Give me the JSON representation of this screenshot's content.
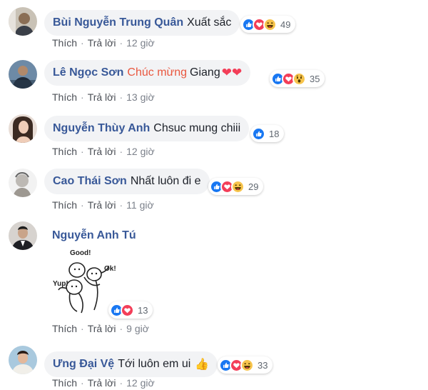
{
  "action_labels": {
    "like": "Thích",
    "reply": "Trả lời",
    "dot": "·"
  },
  "comments": [
    {
      "author": "Bùi Nguyễn Trung Quân",
      "text": "Xuất sắc",
      "reactions": [
        "like-icon",
        "love-icon",
        "haha-icon"
      ],
      "count": "49",
      "time": "12 giờ"
    },
    {
      "author": "Lê Ngọc Sơn",
      "highlight": "Chúc mừng",
      "text": "Giang",
      "hearts": "❤❤",
      "reactions": [
        "like-icon",
        "love-icon",
        "wow-icon"
      ],
      "count": "35",
      "time": "13 giờ"
    },
    {
      "author": "Nguyễn Thùy Anh",
      "text": "Chsuc mung chiii",
      "reactions": [
        "like-icon"
      ],
      "count": "18",
      "time": "12 giờ"
    },
    {
      "author": "Cao Thái Sơn",
      "text": "Nhất luôn đi e",
      "reactions": [
        "like-icon",
        "love-icon",
        "haha-icon"
      ],
      "count": "29",
      "time": "11 giờ"
    },
    {
      "author": "Nguyễn Anh Tú",
      "sticker_text": [
        "Good!",
        "Ok!",
        "Yup!"
      ],
      "reactions": [
        "like-icon",
        "love-icon"
      ],
      "count": "13",
      "time": "9 giờ"
    },
    {
      "author": "Ưng Đại Vệ",
      "text": "Tới luôn em ui",
      "emoji": "👍",
      "reactions": [
        "like-icon",
        "love-icon",
        "haha-icon"
      ],
      "count": "33",
      "time": "12 giờ"
    }
  ],
  "colors": {
    "author": "#385898",
    "bubble": "#f2f3f5",
    "highlight": "#e9573f",
    "like": "#1877f2",
    "love": "#f33e58",
    "haha": "#f7c44c"
  }
}
